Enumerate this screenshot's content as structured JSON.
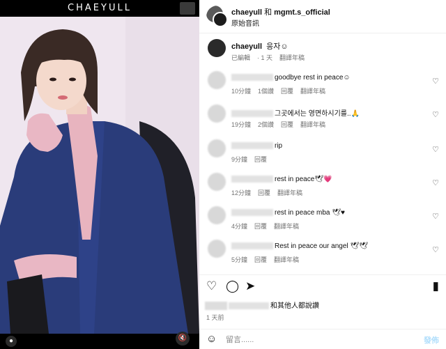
{
  "media": {
    "brand": "CHAEYULL",
    "user_tag_icon": "person-icon",
    "mute_icon": "speaker-mute-icon"
  },
  "header": {
    "username": "chaeyull",
    "connector": "和",
    "collaborator": "mgmt.s_official",
    "subtitle": "原始音訊"
  },
  "caption": {
    "username": "chaeyull",
    "text": "응자☺",
    "meta": [
      "已編輯",
      "· 1 天",
      "翻譯年稿"
    ]
  },
  "comments": [
    {
      "text": "goodbye rest in peace☺",
      "meta": [
        "10分鐘",
        "1個讚",
        "回覆",
        "翻譯年稿"
      ]
    },
    {
      "text": "그곳에서는 영면하시기를..🙏",
      "meta": [
        "19分鐘",
        "2個讚",
        "回覆",
        "翻譯年稿"
      ]
    },
    {
      "text": "rip",
      "meta": [
        "9分鐘",
        "回覆"
      ]
    },
    {
      "text": "rest in peace🕊💗",
      "meta": [
        "12分鐘",
        "回覆",
        "翻譯年稿"
      ]
    },
    {
      "text": "rest in peace mba 🕊♥",
      "meta": [
        "4分鐘",
        "回覆",
        "翻譯年稿"
      ]
    },
    {
      "text": "Rest in peace our angel 🕊🕊",
      "meta": [
        "5分鐘",
        "回覆",
        "翻譯年稿"
      ]
    }
  ],
  "actions": {
    "like_icon": "heart-icon",
    "comment_icon": "comment-icon",
    "share_icon": "send-icon",
    "save_icon": "bookmark-icon"
  },
  "likes_text": "和其他人都說讚",
  "timestamp": "1 天前",
  "add_comment": {
    "placeholder": "留言......",
    "post_label": "發佈"
  },
  "colors": {
    "meta_gray": "#737373",
    "post_blue": "#b2dffc",
    "jacket_navy": "#2a3c7a"
  }
}
